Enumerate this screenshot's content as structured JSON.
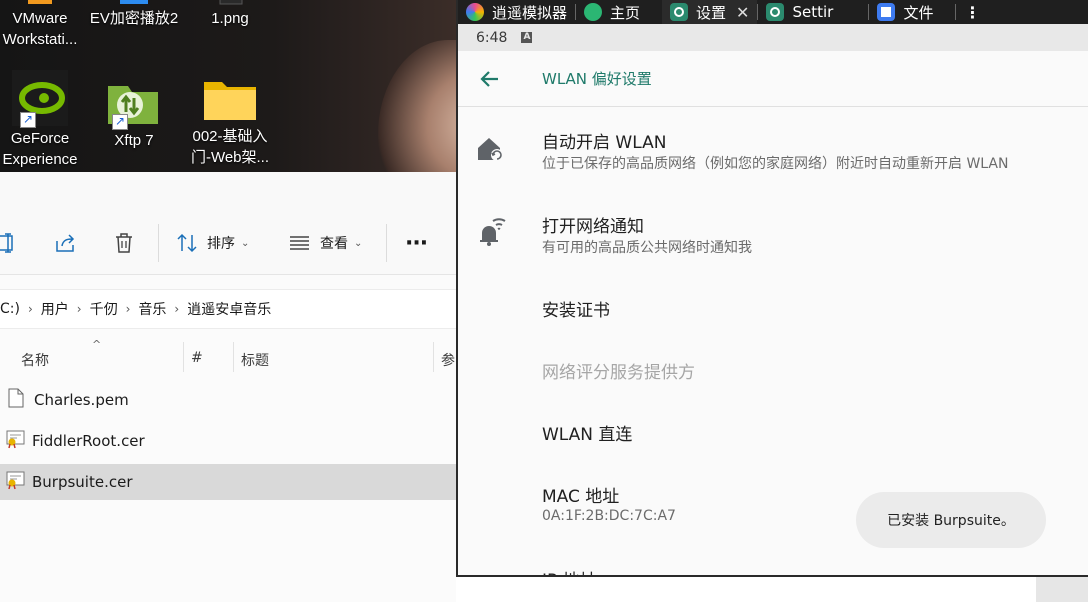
{
  "desktop": {
    "icons": [
      {
        "label": "VMware\nWorkstati...",
        "icon": "vmware-icon"
      },
      {
        "label": "EV加密播放2",
        "icon": "ev-player-icon"
      },
      {
        "label": "1.png",
        "icon": "image-file-icon"
      },
      {
        "label": "GeForce\nExperience",
        "icon": "geforce-icon"
      },
      {
        "label": "Xftp 7",
        "icon": "xftp-icon"
      },
      {
        "label": "002-基础入\n门-Web架...",
        "icon": "folder-icon"
      }
    ]
  },
  "explorer": {
    "toolbar": {
      "sort_label": "排序",
      "view_label": "查看",
      "more_label": "···"
    },
    "breadcrumb": [
      "C:)",
      "用户",
      "千仞",
      "音乐",
      "逍遥安卓音乐"
    ],
    "columns": {
      "name": "名称",
      "number": "#",
      "title": "标题",
      "extra": "参"
    },
    "files": [
      {
        "name": "Charles.pem",
        "icon": "document-icon",
        "selected": false
      },
      {
        "name": "FiddlerRoot.cer",
        "icon": "certificate-icon",
        "selected": false
      },
      {
        "name": "Burpsuite.cer",
        "icon": "certificate-icon",
        "selected": true
      }
    ]
  },
  "emulator": {
    "tabs": [
      {
        "label": "逍遥模拟器",
        "icon": "memu-logo-icon",
        "color": "#e94c8f",
        "active": false
      },
      {
        "label": "主页",
        "icon": "android-home-icon",
        "color": "#2bb673",
        "active": false
      },
      {
        "label": "设置",
        "icon": "settings-gear-icon",
        "color": "#2b8a6e",
        "active": true
      },
      {
        "label": "Settir",
        "icon": "settings-gear-icon",
        "color": "#2b8a6e",
        "active": false
      },
      {
        "label": "文件",
        "icon": "files-icon",
        "color": "#3e7bf0",
        "active": false
      }
    ],
    "status": {
      "time": "6:48",
      "badge": "A"
    },
    "appbar": {
      "title": "WLAN 偏好设置"
    },
    "prefs": [
      {
        "title": "自动开启 WLAN",
        "summary": "位于已保存的高品质网络（例如您的家庭网络）附近时自动重新开启 WLAN",
        "icon": "wifi-auto-on-icon",
        "disabled": false
      },
      {
        "title": "打开网络通知",
        "summary": "有可用的高品质公共网络时通知我",
        "icon": "network-notification-icon",
        "disabled": false
      },
      {
        "title": "安装证书",
        "summary": "",
        "icon": "",
        "disabled": false
      },
      {
        "title": "网络评分服务提供方",
        "summary": "",
        "icon": "",
        "disabled": true
      },
      {
        "title": "WLAN 直连",
        "summary": "",
        "icon": "",
        "disabled": false
      },
      {
        "title": "MAC 地址",
        "summary": "0A:1F:2B:DC:7C:A7",
        "icon": "",
        "disabled": false
      },
      {
        "title": "IP 地址",
        "summary": "",
        "icon": "",
        "disabled": false
      }
    ],
    "toast": "已安装 Burpsuite。",
    "accent": "#1f7a6a"
  }
}
